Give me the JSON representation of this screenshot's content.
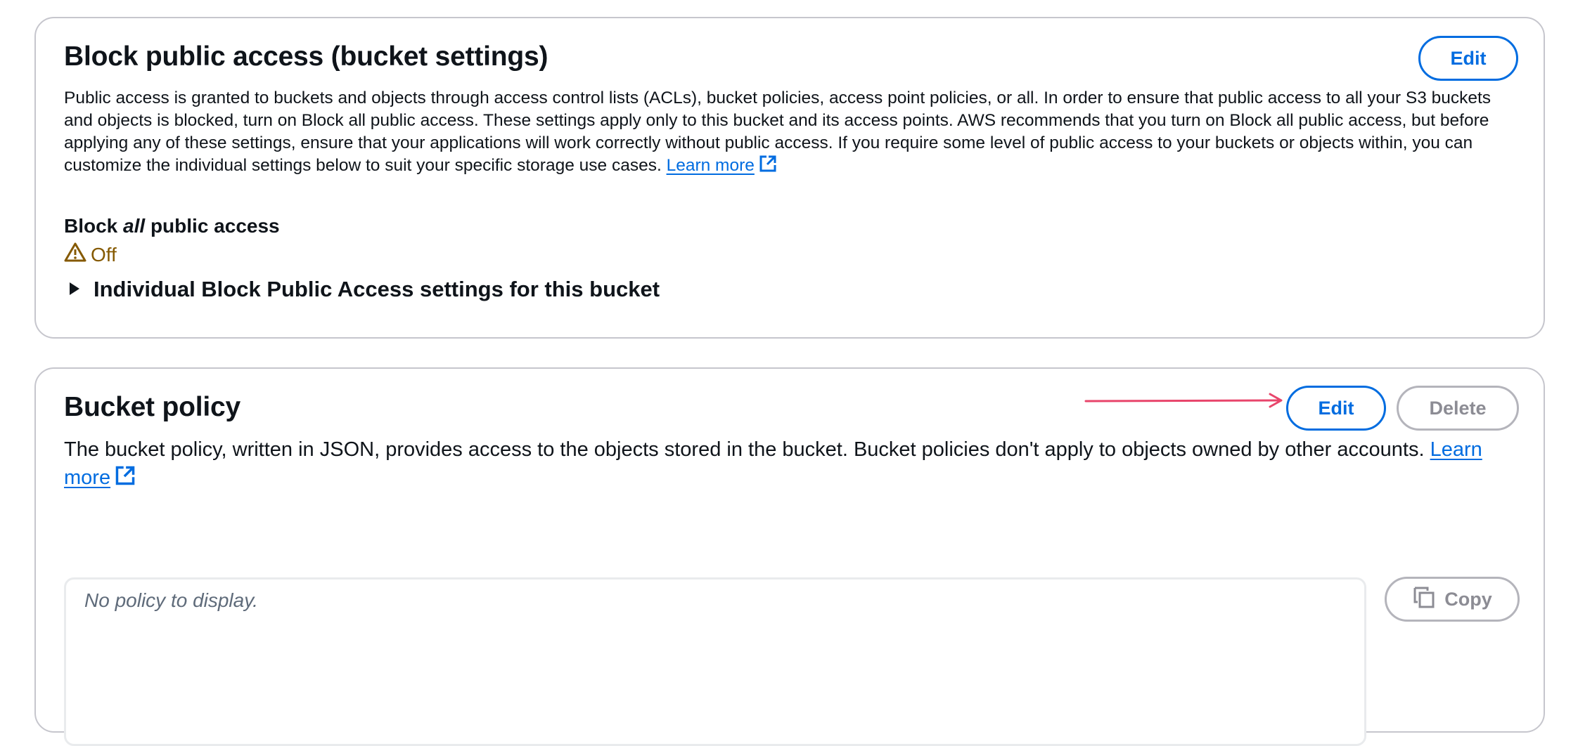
{
  "block_public_access": {
    "title": "Block public access (bucket settings)",
    "edit_label": "Edit",
    "description": "Public access is granted to buckets and objects through access control lists (ACLs), bucket policies, access point policies, or all. In order to ensure that public access to all your S3 buckets and objects is blocked, turn on Block all public access. These settings apply only to this bucket and its access points. AWS recommends that you turn on Block all public access, but before applying any of these settings, ensure that your applications will work correctly without public access. If you require some level of public access to your buckets or objects within, you can customize the individual settings below to suit your specific storage use cases.",
    "learn_more": "Learn more",
    "block_all_prefix": "Block ",
    "block_all_emphasis": "all",
    "block_all_suffix": " public access",
    "status": "Off",
    "status_icon": "warning-icon",
    "expander_label": "Individual Block Public Access settings for this bucket"
  },
  "bucket_policy": {
    "title": "Bucket policy",
    "edit_label": "Edit",
    "delete_label": "Delete",
    "description": "The bucket policy, written in JSON, provides access to the objects stored in the bucket. Bucket policies don't apply to objects owned by other accounts.",
    "learn_more": "Learn more",
    "empty_text": "No policy to display.",
    "copy_label": "Copy",
    "copy_icon": "copy-icon"
  },
  "colors": {
    "link_blue": "#006ce0",
    "warning_brown": "#855900",
    "annotation_arrow": "#e8456b",
    "border_gray": "#c6c6cd",
    "disabled_gray": "#8c8c94"
  }
}
